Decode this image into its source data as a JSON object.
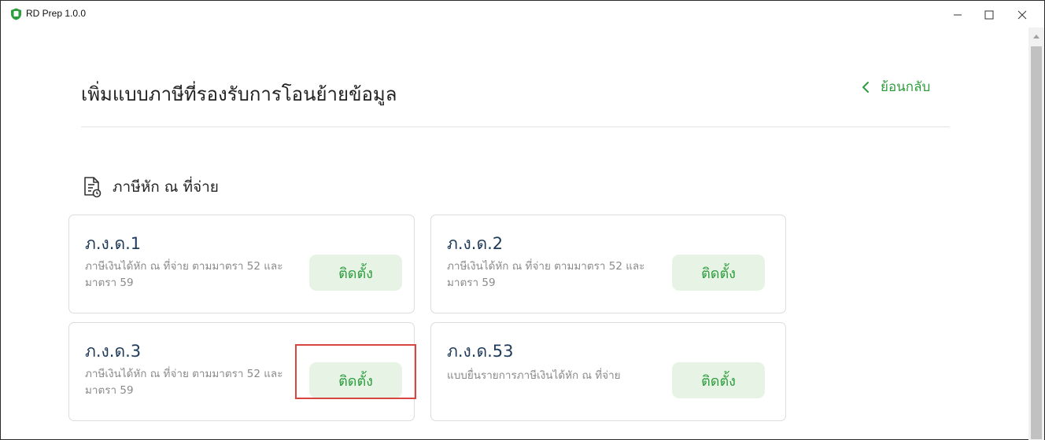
{
  "window": {
    "title": "RD Prep 1.0.0",
    "accent_color": "#2e9d3e",
    "logo_color": "#2e9d3e",
    "controls": [
      "minimize-icon",
      "maximize-icon",
      "close-icon"
    ]
  },
  "header": {
    "title": "เพิ่มแบบภาษีที่รองรับการโอนย้ายข้อมูล",
    "back_label": "ย้อนกลับ"
  },
  "section": {
    "title": "ภาษีหัก ณ ที่จ่าย",
    "icon": "document-icon"
  },
  "cards": [
    {
      "name": "ภ.ง.ด.1",
      "description": "ภาษีเงินได้หัก ณ ที่จ่าย ตามมาตรา 52 และมาตรา 59",
      "button": "ติดตั้ง"
    },
    {
      "name": "ภ.ง.ด.2",
      "description": "ภาษีเงินได้หัก ณ ที่จ่าย ตามมาตรา 52 และมาตรา 59",
      "button": "ติดตั้ง"
    },
    {
      "name": "ภ.ง.ด.3",
      "description": "ภาษีเงินได้หัก ณ ที่จ่าย ตามมาตรา 52 และมาตรา 59",
      "button": "ติดตั้ง"
    },
    {
      "name": "ภ.ง.ด.53",
      "description": "แบบยื่นรายการภาษีเงินได้หัก ณ ที่จ่าย",
      "button": "ติดตั้ง"
    }
  ],
  "highlight_color": "#d9453f"
}
